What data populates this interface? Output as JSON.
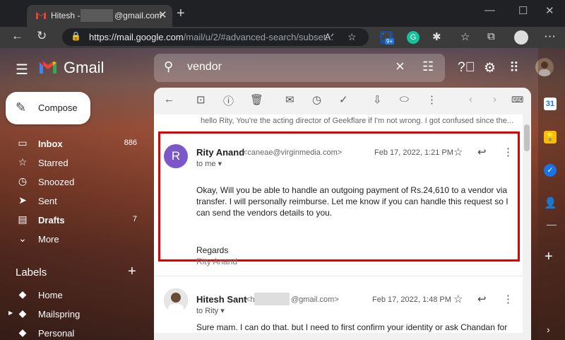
{
  "browser": {
    "tab_title": "Hitesh - h",
    "tab_title_suffix": "@gmail.com",
    "url_main": "https://mail.google.com",
    "url_rest": "/mail/u/2/#advanced-search/subset...",
    "ext_badge": "9+"
  },
  "gmail": {
    "logo_text": "Gmail",
    "search_query": "vendor",
    "compose_label": "Compose",
    "nav": [
      {
        "label": "Inbox",
        "count": "886",
        "bold": true
      },
      {
        "label": "Starred",
        "count": ""
      },
      {
        "label": "Snoozed",
        "count": ""
      },
      {
        "label": "Sent",
        "count": ""
      },
      {
        "label": "Drafts",
        "count": "7",
        "bold": true
      },
      {
        "label": "More",
        "count": ""
      }
    ],
    "labels_heading": "Labels",
    "labels": [
      "Home",
      "Mailspring",
      "Personal"
    ]
  },
  "thread": {
    "prev_snippet": "hello Rity, You're the acting director of Geekflare if I'm not wrong. I got confused since the...",
    "msg1": {
      "avatar_letter": "R",
      "sender": "Rity Anand",
      "email": "<caneae@virginmedia.com>",
      "date": "Feb 17, 2022, 1:21 PM",
      "to": "to me",
      "body": "Okay, Will you be able to handle an outgoing payment of Rs.24,610 to a vendor via transfer. I will personally reimburse. Let me know if you can handle this request so I can send the vendors details to you.",
      "regards": "Regards",
      "signature": "Rity Anand"
    },
    "msg2": {
      "sender": "Hitesh Sant",
      "email_prefix": "<h",
      "email_suffix": "@gmail.com>",
      "date": "Feb 17, 2022, 1:48 PM",
      "to": "to Rity",
      "body": "Sure mam. I can do that. but I need to first confirm your identity or ask Chandan for"
    }
  },
  "colors": {
    "highlight": "#e00000",
    "avatar_r": "#7b57c8"
  }
}
